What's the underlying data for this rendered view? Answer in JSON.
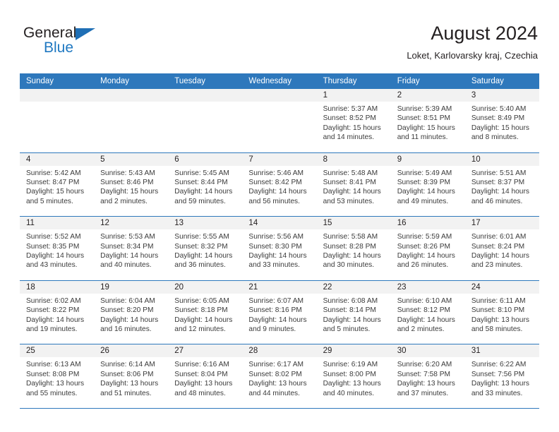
{
  "brand": {
    "word_one": "General",
    "word_two": "Blue",
    "triangle_icon": "brand-triangle-icon",
    "accent_color": "#1f78c1"
  },
  "header": {
    "month_title": "August 2024",
    "location": "Loket, Karlovarsky kraj, Czechia"
  },
  "calendar": {
    "header_color": "#2e78bc",
    "daynum_band_color": "#f2f2f2",
    "day_names": [
      "Sunday",
      "Monday",
      "Tuesday",
      "Wednesday",
      "Thursday",
      "Friday",
      "Saturday"
    ],
    "weeks": [
      [
        {
          "day": "",
          "empty": true
        },
        {
          "day": "",
          "empty": true
        },
        {
          "day": "",
          "empty": true
        },
        {
          "day": "",
          "empty": true
        },
        {
          "day": "1",
          "sunrise": "Sunrise: 5:37 AM",
          "sunset": "Sunset: 8:52 PM",
          "daylight": "Daylight: 15 hours and 14 minutes."
        },
        {
          "day": "2",
          "sunrise": "Sunrise: 5:39 AM",
          "sunset": "Sunset: 8:51 PM",
          "daylight": "Daylight: 15 hours and 11 minutes."
        },
        {
          "day": "3",
          "sunrise": "Sunrise: 5:40 AM",
          "sunset": "Sunset: 8:49 PM",
          "daylight": "Daylight: 15 hours and 8 minutes."
        }
      ],
      [
        {
          "day": "4",
          "sunrise": "Sunrise: 5:42 AM",
          "sunset": "Sunset: 8:47 PM",
          "daylight": "Daylight: 15 hours and 5 minutes."
        },
        {
          "day": "5",
          "sunrise": "Sunrise: 5:43 AM",
          "sunset": "Sunset: 8:46 PM",
          "daylight": "Daylight: 15 hours and 2 minutes."
        },
        {
          "day": "6",
          "sunrise": "Sunrise: 5:45 AM",
          "sunset": "Sunset: 8:44 PM",
          "daylight": "Daylight: 14 hours and 59 minutes."
        },
        {
          "day": "7",
          "sunrise": "Sunrise: 5:46 AM",
          "sunset": "Sunset: 8:42 PM",
          "daylight": "Daylight: 14 hours and 56 minutes."
        },
        {
          "day": "8",
          "sunrise": "Sunrise: 5:48 AM",
          "sunset": "Sunset: 8:41 PM",
          "daylight": "Daylight: 14 hours and 53 minutes."
        },
        {
          "day": "9",
          "sunrise": "Sunrise: 5:49 AM",
          "sunset": "Sunset: 8:39 PM",
          "daylight": "Daylight: 14 hours and 49 minutes."
        },
        {
          "day": "10",
          "sunrise": "Sunrise: 5:51 AM",
          "sunset": "Sunset: 8:37 PM",
          "daylight": "Daylight: 14 hours and 46 minutes."
        }
      ],
      [
        {
          "day": "11",
          "sunrise": "Sunrise: 5:52 AM",
          "sunset": "Sunset: 8:35 PM",
          "daylight": "Daylight: 14 hours and 43 minutes."
        },
        {
          "day": "12",
          "sunrise": "Sunrise: 5:53 AM",
          "sunset": "Sunset: 8:34 PM",
          "daylight": "Daylight: 14 hours and 40 minutes."
        },
        {
          "day": "13",
          "sunrise": "Sunrise: 5:55 AM",
          "sunset": "Sunset: 8:32 PM",
          "daylight": "Daylight: 14 hours and 36 minutes."
        },
        {
          "day": "14",
          "sunrise": "Sunrise: 5:56 AM",
          "sunset": "Sunset: 8:30 PM",
          "daylight": "Daylight: 14 hours and 33 minutes."
        },
        {
          "day": "15",
          "sunrise": "Sunrise: 5:58 AM",
          "sunset": "Sunset: 8:28 PM",
          "daylight": "Daylight: 14 hours and 30 minutes."
        },
        {
          "day": "16",
          "sunrise": "Sunrise: 5:59 AM",
          "sunset": "Sunset: 8:26 PM",
          "daylight": "Daylight: 14 hours and 26 minutes."
        },
        {
          "day": "17",
          "sunrise": "Sunrise: 6:01 AM",
          "sunset": "Sunset: 8:24 PM",
          "daylight": "Daylight: 14 hours and 23 minutes."
        }
      ],
      [
        {
          "day": "18",
          "sunrise": "Sunrise: 6:02 AM",
          "sunset": "Sunset: 8:22 PM",
          "daylight": "Daylight: 14 hours and 19 minutes."
        },
        {
          "day": "19",
          "sunrise": "Sunrise: 6:04 AM",
          "sunset": "Sunset: 8:20 PM",
          "daylight": "Daylight: 14 hours and 16 minutes."
        },
        {
          "day": "20",
          "sunrise": "Sunrise: 6:05 AM",
          "sunset": "Sunset: 8:18 PM",
          "daylight": "Daylight: 14 hours and 12 minutes."
        },
        {
          "day": "21",
          "sunrise": "Sunrise: 6:07 AM",
          "sunset": "Sunset: 8:16 PM",
          "daylight": "Daylight: 14 hours and 9 minutes."
        },
        {
          "day": "22",
          "sunrise": "Sunrise: 6:08 AM",
          "sunset": "Sunset: 8:14 PM",
          "daylight": "Daylight: 14 hours and 5 minutes."
        },
        {
          "day": "23",
          "sunrise": "Sunrise: 6:10 AM",
          "sunset": "Sunset: 8:12 PM",
          "daylight": "Daylight: 14 hours and 2 minutes."
        },
        {
          "day": "24",
          "sunrise": "Sunrise: 6:11 AM",
          "sunset": "Sunset: 8:10 PM",
          "daylight": "Daylight: 13 hours and 58 minutes."
        }
      ],
      [
        {
          "day": "25",
          "sunrise": "Sunrise: 6:13 AM",
          "sunset": "Sunset: 8:08 PM",
          "daylight": "Daylight: 13 hours and 55 minutes."
        },
        {
          "day": "26",
          "sunrise": "Sunrise: 6:14 AM",
          "sunset": "Sunset: 8:06 PM",
          "daylight": "Daylight: 13 hours and 51 minutes."
        },
        {
          "day": "27",
          "sunrise": "Sunrise: 6:16 AM",
          "sunset": "Sunset: 8:04 PM",
          "daylight": "Daylight: 13 hours and 48 minutes."
        },
        {
          "day": "28",
          "sunrise": "Sunrise: 6:17 AM",
          "sunset": "Sunset: 8:02 PM",
          "daylight": "Daylight: 13 hours and 44 minutes."
        },
        {
          "day": "29",
          "sunrise": "Sunrise: 6:19 AM",
          "sunset": "Sunset: 8:00 PM",
          "daylight": "Daylight: 13 hours and 40 minutes."
        },
        {
          "day": "30",
          "sunrise": "Sunrise: 6:20 AM",
          "sunset": "Sunset: 7:58 PM",
          "daylight": "Daylight: 13 hours and 37 minutes."
        },
        {
          "day": "31",
          "sunrise": "Sunrise: 6:22 AM",
          "sunset": "Sunset: 7:56 PM",
          "daylight": "Daylight: 13 hours and 33 minutes."
        }
      ]
    ]
  }
}
